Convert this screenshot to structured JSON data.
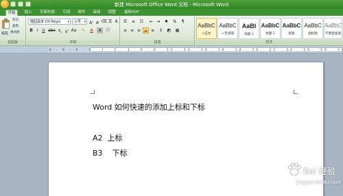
{
  "window": {
    "title": "新建 Microsoft Office Word 文档 - Microsoft Word"
  },
  "tabs": [
    "开始",
    "插入",
    "页面布局",
    "引用",
    "邮件",
    "审阅",
    "视图",
    "福昕PDF"
  ],
  "ribbon": {
    "clipboard": {
      "paste": "粘贴",
      "cut": "剪切",
      "copy": "复制",
      "format_painter": "格式刷",
      "label": "剪贴板"
    },
    "font": {
      "font_name": "楷园黑体 CN Regul",
      "font_size": "三号",
      "label": "字体"
    },
    "paragraph": {
      "label": "段落"
    },
    "styles": {
      "label": "样式",
      "items": [
        {
          "sample": "AaBbC",
          "name": "↵正文"
        },
        {
          "sample": "AaBbC",
          "name": "↵无间隔"
        },
        {
          "sample": "AaBl",
          "name": "标题 1"
        },
        {
          "sample": "AaBbC",
          "name": "标题 2"
        },
        {
          "sample": "AaBbC",
          "name": "标题"
        },
        {
          "sample": "AaBbC",
          "name": "副标题"
        },
        {
          "sample": "AaBbC",
          "name": "不明显强调"
        }
      ]
    }
  },
  "ruler": {
    "numbers": "8 · 6 · 4 · 2 · | · 2 · 4 · 6 · 8 · 10 · 12 · 14 · 16 · 18 · 20 · 22 · 24 · 26 · 28 · 30 · 32 · 34 · 36 · 38 · 40 · 42 · 44"
  },
  "document": {
    "lines": [
      "Word 如何快速的添加上标和下标",
      "A2  上标",
      "B3    下标"
    ]
  },
  "watermark": {
    "text": "Bai 经验",
    "url": "jingyan.baidu.com"
  }
}
